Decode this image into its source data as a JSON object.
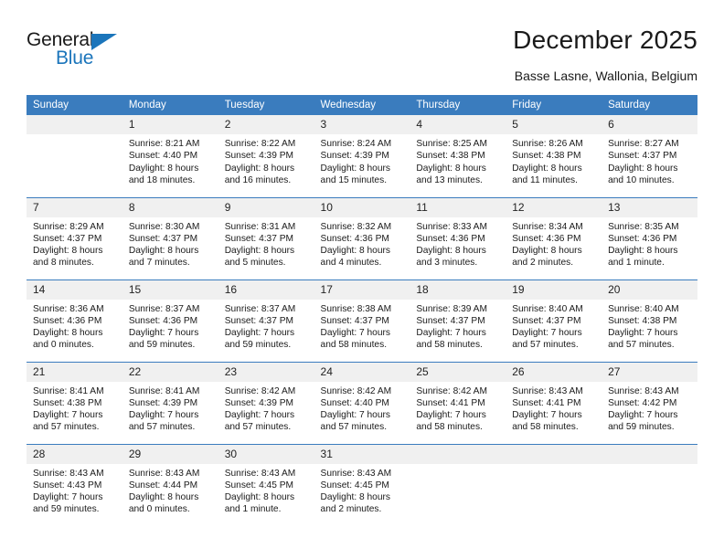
{
  "brand": {
    "name_part1": "General",
    "name_part2": "Blue",
    "accent_color": "#1b75bb"
  },
  "header": {
    "title": "December 2025",
    "subtitle": "Basse Lasne, Wallonia, Belgium"
  },
  "calendar": {
    "header_bg": "#3a7cbe",
    "daynum_bg": "#f0f0f0",
    "weekday_headers": [
      "Sunday",
      "Monday",
      "Tuesday",
      "Wednesday",
      "Thursday",
      "Friday",
      "Saturday"
    ],
    "weeks": [
      [
        {
          "day": "",
          "lines": []
        },
        {
          "day": "1",
          "lines": [
            "Sunrise: 8:21 AM",
            "Sunset: 4:40 PM",
            "Daylight: 8 hours",
            "and 18 minutes."
          ]
        },
        {
          "day": "2",
          "lines": [
            "Sunrise: 8:22 AM",
            "Sunset: 4:39 PM",
            "Daylight: 8 hours",
            "and 16 minutes."
          ]
        },
        {
          "day": "3",
          "lines": [
            "Sunrise: 8:24 AM",
            "Sunset: 4:39 PM",
            "Daylight: 8 hours",
            "and 15 minutes."
          ]
        },
        {
          "day": "4",
          "lines": [
            "Sunrise: 8:25 AM",
            "Sunset: 4:38 PM",
            "Daylight: 8 hours",
            "and 13 minutes."
          ]
        },
        {
          "day": "5",
          "lines": [
            "Sunrise: 8:26 AM",
            "Sunset: 4:38 PM",
            "Daylight: 8 hours",
            "and 11 minutes."
          ]
        },
        {
          "day": "6",
          "lines": [
            "Sunrise: 8:27 AM",
            "Sunset: 4:37 PM",
            "Daylight: 8 hours",
            "and 10 minutes."
          ]
        }
      ],
      [
        {
          "day": "7",
          "lines": [
            "Sunrise: 8:29 AM",
            "Sunset: 4:37 PM",
            "Daylight: 8 hours",
            "and 8 minutes."
          ]
        },
        {
          "day": "8",
          "lines": [
            "Sunrise: 8:30 AM",
            "Sunset: 4:37 PM",
            "Daylight: 8 hours",
            "and 7 minutes."
          ]
        },
        {
          "day": "9",
          "lines": [
            "Sunrise: 8:31 AM",
            "Sunset: 4:37 PM",
            "Daylight: 8 hours",
            "and 5 minutes."
          ]
        },
        {
          "day": "10",
          "lines": [
            "Sunrise: 8:32 AM",
            "Sunset: 4:36 PM",
            "Daylight: 8 hours",
            "and 4 minutes."
          ]
        },
        {
          "day": "11",
          "lines": [
            "Sunrise: 8:33 AM",
            "Sunset: 4:36 PM",
            "Daylight: 8 hours",
            "and 3 minutes."
          ]
        },
        {
          "day": "12",
          "lines": [
            "Sunrise: 8:34 AM",
            "Sunset: 4:36 PM",
            "Daylight: 8 hours",
            "and 2 minutes."
          ]
        },
        {
          "day": "13",
          "lines": [
            "Sunrise: 8:35 AM",
            "Sunset: 4:36 PM",
            "Daylight: 8 hours",
            "and 1 minute."
          ]
        }
      ],
      [
        {
          "day": "14",
          "lines": [
            "Sunrise: 8:36 AM",
            "Sunset: 4:36 PM",
            "Daylight: 8 hours",
            "and 0 minutes."
          ]
        },
        {
          "day": "15",
          "lines": [
            "Sunrise: 8:37 AM",
            "Sunset: 4:36 PM",
            "Daylight: 7 hours",
            "and 59 minutes."
          ]
        },
        {
          "day": "16",
          "lines": [
            "Sunrise: 8:37 AM",
            "Sunset: 4:37 PM",
            "Daylight: 7 hours",
            "and 59 minutes."
          ]
        },
        {
          "day": "17",
          "lines": [
            "Sunrise: 8:38 AM",
            "Sunset: 4:37 PM",
            "Daylight: 7 hours",
            "and 58 minutes."
          ]
        },
        {
          "day": "18",
          "lines": [
            "Sunrise: 8:39 AM",
            "Sunset: 4:37 PM",
            "Daylight: 7 hours",
            "and 58 minutes."
          ]
        },
        {
          "day": "19",
          "lines": [
            "Sunrise: 8:40 AM",
            "Sunset: 4:37 PM",
            "Daylight: 7 hours",
            "and 57 minutes."
          ]
        },
        {
          "day": "20",
          "lines": [
            "Sunrise: 8:40 AM",
            "Sunset: 4:38 PM",
            "Daylight: 7 hours",
            "and 57 minutes."
          ]
        }
      ],
      [
        {
          "day": "21",
          "lines": [
            "Sunrise: 8:41 AM",
            "Sunset: 4:38 PM",
            "Daylight: 7 hours",
            "and 57 minutes."
          ]
        },
        {
          "day": "22",
          "lines": [
            "Sunrise: 8:41 AM",
            "Sunset: 4:39 PM",
            "Daylight: 7 hours",
            "and 57 minutes."
          ]
        },
        {
          "day": "23",
          "lines": [
            "Sunrise: 8:42 AM",
            "Sunset: 4:39 PM",
            "Daylight: 7 hours",
            "and 57 minutes."
          ]
        },
        {
          "day": "24",
          "lines": [
            "Sunrise: 8:42 AM",
            "Sunset: 4:40 PM",
            "Daylight: 7 hours",
            "and 57 minutes."
          ]
        },
        {
          "day": "25",
          "lines": [
            "Sunrise: 8:42 AM",
            "Sunset: 4:41 PM",
            "Daylight: 7 hours",
            "and 58 minutes."
          ]
        },
        {
          "day": "26",
          "lines": [
            "Sunrise: 8:43 AM",
            "Sunset: 4:41 PM",
            "Daylight: 7 hours",
            "and 58 minutes."
          ]
        },
        {
          "day": "27",
          "lines": [
            "Sunrise: 8:43 AM",
            "Sunset: 4:42 PM",
            "Daylight: 7 hours",
            "and 59 minutes."
          ]
        }
      ],
      [
        {
          "day": "28",
          "lines": [
            "Sunrise: 8:43 AM",
            "Sunset: 4:43 PM",
            "Daylight: 7 hours",
            "and 59 minutes."
          ]
        },
        {
          "day": "29",
          "lines": [
            "Sunrise: 8:43 AM",
            "Sunset: 4:44 PM",
            "Daylight: 8 hours",
            "and 0 minutes."
          ]
        },
        {
          "day": "30",
          "lines": [
            "Sunrise: 8:43 AM",
            "Sunset: 4:45 PM",
            "Daylight: 8 hours",
            "and 1 minute."
          ]
        },
        {
          "day": "31",
          "lines": [
            "Sunrise: 8:43 AM",
            "Sunset: 4:45 PM",
            "Daylight: 8 hours",
            "and 2 minutes."
          ]
        },
        {
          "day": "",
          "lines": []
        },
        {
          "day": "",
          "lines": []
        },
        {
          "day": "",
          "lines": []
        }
      ]
    ]
  }
}
